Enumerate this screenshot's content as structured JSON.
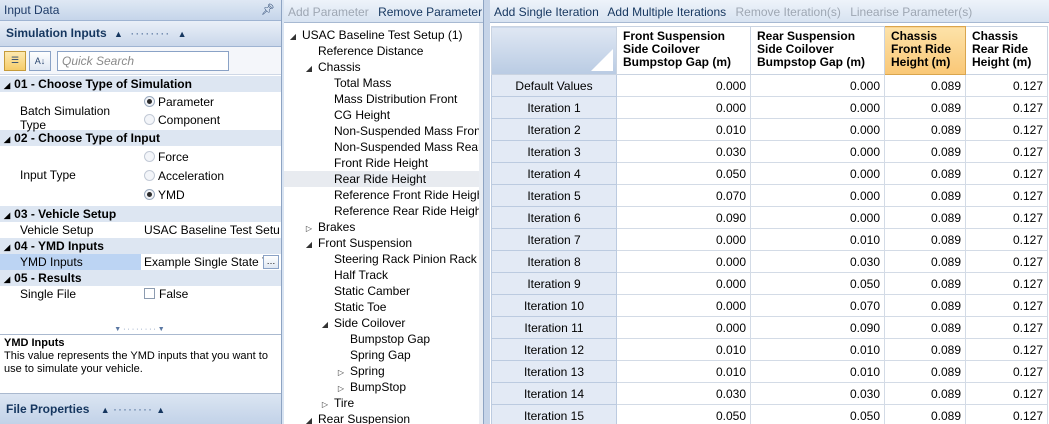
{
  "left": {
    "title": "Input Data",
    "section_title": "Simulation Inputs",
    "search_placeholder": "Quick Search",
    "categories": [
      {
        "name": "01 - Choose Type of Simulation"
      },
      {
        "name": "02 - Choose Type of Input"
      },
      {
        "name": "03 - Vehicle Setup"
      },
      {
        "name": "04 - YMD Inputs"
      },
      {
        "name": "05 - Results"
      }
    ],
    "batch_sim_label": "Batch Simulation Type",
    "batch_options": [
      "Parameter",
      "Component"
    ],
    "input_type_label": "Input Type",
    "input_options": [
      "Force",
      "Acceleration",
      "YMD"
    ],
    "vehicle_setup_label": "Vehicle Setup",
    "vehicle_setup_value": "USAC Baseline Test Setu",
    "ymd_inputs_label": "YMD Inputs",
    "ymd_inputs_value": "Example Single State Y",
    "single_file_label": "Single File",
    "single_file_value": "False",
    "desc_title": "YMD Inputs",
    "desc_text": "This value represents the YMD inputs that you want to use to simulate your vehicle.",
    "file_properties": "File Properties"
  },
  "mid": {
    "toolbar": {
      "add": "Add Parameter",
      "remove": "Remove Parameter"
    },
    "tree": [
      {
        "label": "USAC Baseline Test Setup (1)",
        "level": 0,
        "exp": "open"
      },
      {
        "label": "Reference Distance",
        "level": 1,
        "exp": ""
      },
      {
        "label": "Chassis",
        "level": 1,
        "exp": "open"
      },
      {
        "label": "Total Mass",
        "level": 2,
        "exp": ""
      },
      {
        "label": "Mass Distribution Front",
        "level": 2,
        "exp": ""
      },
      {
        "label": "CG Height",
        "level": 2,
        "exp": ""
      },
      {
        "label": "Non-Suspended Mass Front",
        "level": 2,
        "exp": ""
      },
      {
        "label": "Non-Suspended Mass Rear",
        "level": 2,
        "exp": ""
      },
      {
        "label": "Front Ride Height",
        "level": 2,
        "exp": ""
      },
      {
        "label": "Rear Ride Height",
        "level": 2,
        "exp": "",
        "selected": true
      },
      {
        "label": "Reference Front Ride Height",
        "level": 2,
        "exp": ""
      },
      {
        "label": "Reference Rear Ride Height",
        "level": 2,
        "exp": ""
      },
      {
        "label": "Brakes",
        "level": 1,
        "exp": "closed"
      },
      {
        "label": "Front Suspension",
        "level": 1,
        "exp": "open"
      },
      {
        "label": "Steering Rack Pinion Rack F",
        "level": 2,
        "exp": ""
      },
      {
        "label": "Half Track",
        "level": 2,
        "exp": ""
      },
      {
        "label": "Static Camber",
        "level": 2,
        "exp": ""
      },
      {
        "label": "Static Toe",
        "level": 2,
        "exp": ""
      },
      {
        "label": "Side Coilover",
        "level": 2,
        "exp": "open"
      },
      {
        "label": "Bumpstop Gap",
        "level": 3,
        "exp": ""
      },
      {
        "label": "Spring Gap",
        "level": 3,
        "exp": ""
      },
      {
        "label": "Spring",
        "level": 3,
        "exp": "closed"
      },
      {
        "label": "BumpStop",
        "level": 3,
        "exp": "closed"
      },
      {
        "label": "Tire",
        "level": 2,
        "exp": "closed"
      },
      {
        "label": "Rear Suspension",
        "level": 1,
        "exp": "open"
      }
    ]
  },
  "right": {
    "toolbar": {
      "add_single": "Add Single Iteration",
      "add_multiple": "Add Multiple Iterations",
      "remove": "Remove Iteration(s)",
      "linearise": "Linearise Parameter(s)"
    },
    "columns": [
      "Front Suspension Side Coilover Bumpstop Gap (m)",
      "Rear Suspension Side Coilover Bumpstop Gap (m)",
      "Chassis Front Ride Height (m)",
      "Chassis Rear Ride Height (m)"
    ],
    "rows": [
      {
        "label": "Default Values",
        "values": [
          "0.000",
          "0.000",
          "0.089",
          "0.127"
        ]
      },
      {
        "label": "Iteration 1",
        "values": [
          "0.000",
          "0.000",
          "0.089",
          "0.127"
        ]
      },
      {
        "label": "Iteration 2",
        "values": [
          "0.010",
          "0.000",
          "0.089",
          "0.127"
        ]
      },
      {
        "label": "Iteration 3",
        "values": [
          "0.030",
          "0.000",
          "0.089",
          "0.127"
        ]
      },
      {
        "label": "Iteration 4",
        "values": [
          "0.050",
          "0.000",
          "0.089",
          "0.127"
        ]
      },
      {
        "label": "Iteration 5",
        "values": [
          "0.070",
          "0.000",
          "0.089",
          "0.127"
        ]
      },
      {
        "label": "Iteration 6",
        "values": [
          "0.090",
          "0.000",
          "0.089",
          "0.127"
        ]
      },
      {
        "label": "Iteration 7",
        "values": [
          "0.000",
          "0.010",
          "0.089",
          "0.127"
        ]
      },
      {
        "label": "Iteration 8",
        "values": [
          "0.000",
          "0.030",
          "0.089",
          "0.127"
        ]
      },
      {
        "label": "Iteration 9",
        "values": [
          "0.000",
          "0.050",
          "0.089",
          "0.127"
        ]
      },
      {
        "label": "Iteration 10",
        "values": [
          "0.000",
          "0.070",
          "0.089",
          "0.127"
        ]
      },
      {
        "label": "Iteration 11",
        "values": [
          "0.000",
          "0.090",
          "0.089",
          "0.127"
        ]
      },
      {
        "label": "Iteration 12",
        "values": [
          "0.010",
          "0.010",
          "0.089",
          "0.127"
        ]
      },
      {
        "label": "Iteration 13",
        "values": [
          "0.010",
          "0.010",
          "0.089",
          "0.127"
        ]
      },
      {
        "label": "Iteration 14",
        "values": [
          "0.030",
          "0.030",
          "0.089",
          "0.127"
        ]
      },
      {
        "label": "Iteration 15",
        "values": [
          "0.050",
          "0.050",
          "0.089",
          "0.127"
        ]
      }
    ]
  }
}
